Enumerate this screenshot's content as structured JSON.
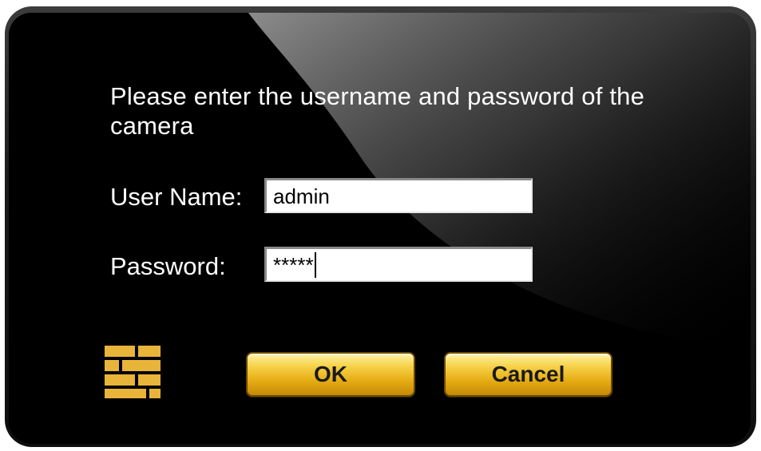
{
  "dialog": {
    "prompt": "Please enter the username and password of the camera",
    "username": {
      "label": "User Name:",
      "value": "admin"
    },
    "password": {
      "label": "Password:",
      "value": "*****"
    },
    "buttons": {
      "ok": "OK",
      "cancel": "Cancel"
    },
    "logo_icon": "brick-wall-icon"
  },
  "colors": {
    "background": "#000000",
    "text": "#ffffff",
    "button_gold": "#e6ac14",
    "logo_gold": "#e8b43a"
  }
}
